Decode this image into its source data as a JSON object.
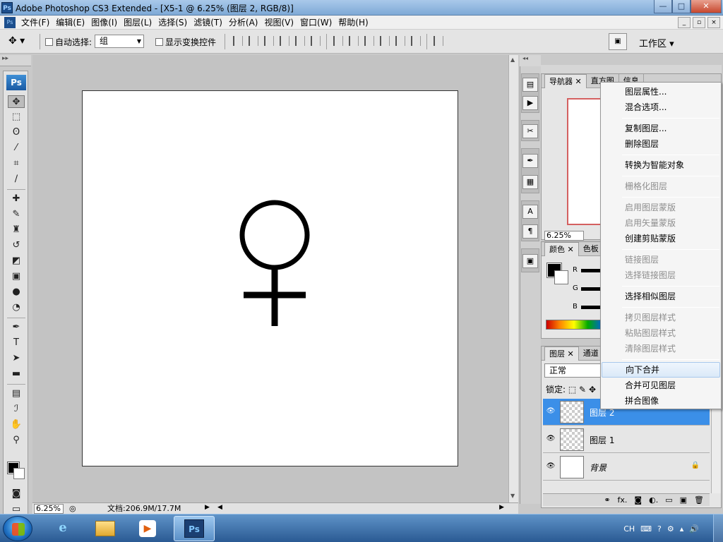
{
  "window": {
    "title": "Adobe Photoshop CS3 Extended - [X5-1 @ 6.25% (图层 2, RGB/8)]",
    "app_icon": "Ps",
    "controls": {
      "minimize": "—",
      "maximize": "□",
      "close": "✕"
    }
  },
  "menu": {
    "items": [
      "文件(F)",
      "编辑(E)",
      "图像(I)",
      "图层(L)",
      "选择(S)",
      "滤镜(T)",
      "分析(A)",
      "视图(V)",
      "窗口(W)",
      "帮助(H)"
    ],
    "doc_controls": [
      "_",
      "▫",
      "×"
    ]
  },
  "options": {
    "auto_select_label": "自动选择:",
    "auto_select_value": "组",
    "show_transform_label": "显示变换控件",
    "workspace_label": "工作区 ▾"
  },
  "toolbox": {
    "logo": "Ps",
    "tools": [
      {
        "name": "move-tool-icon",
        "glyph": "✥"
      },
      {
        "name": "marquee-tool-icon",
        "glyph": "⬚"
      },
      {
        "name": "lasso-tool-icon",
        "glyph": "ʘ"
      },
      {
        "name": "magic-wand-tool-icon",
        "glyph": "⁄"
      },
      {
        "name": "crop-tool-icon",
        "glyph": "⌗"
      },
      {
        "name": "slice-tool-icon",
        "glyph": "∕"
      },
      {
        "name": "healing-brush-tool-icon",
        "glyph": "✚"
      },
      {
        "name": "brush-tool-icon",
        "glyph": "✎"
      },
      {
        "name": "clone-stamp-tool-icon",
        "glyph": "♜"
      },
      {
        "name": "history-brush-tool-icon",
        "glyph": "↺"
      },
      {
        "name": "eraser-tool-icon",
        "glyph": "◩"
      },
      {
        "name": "gradient-tool-icon",
        "glyph": "▣"
      },
      {
        "name": "blur-tool-icon",
        "glyph": "●"
      },
      {
        "name": "dodge-tool-icon",
        "glyph": "◔"
      },
      {
        "name": "pen-tool-icon",
        "glyph": "✒"
      },
      {
        "name": "type-tool-icon",
        "glyph": "T"
      },
      {
        "name": "path-selection-tool-icon",
        "glyph": "➤"
      },
      {
        "name": "shape-tool-icon",
        "glyph": "▬"
      },
      {
        "name": "notes-tool-icon",
        "glyph": "▤"
      },
      {
        "name": "eyedropper-tool-icon",
        "glyph": "ℐ"
      },
      {
        "name": "hand-tool-icon",
        "glyph": "✋"
      },
      {
        "name": "zoom-tool-icon",
        "glyph": "⚲"
      }
    ]
  },
  "status": {
    "zoom": "6.25%",
    "doc_info": "文档:206.9M/17.7M"
  },
  "panels": {
    "navigator_tabs": [
      "导航器",
      "直方图",
      "信息"
    ],
    "navigator_zoom": "6.25%",
    "color_tabs": [
      "颜色",
      "色板"
    ],
    "channels": [
      "R",
      "G",
      "B"
    ],
    "layer_tabs": [
      "图层",
      "通道"
    ],
    "blend_mode": "正常",
    "lock_label": "锁定:",
    "layers": [
      {
        "name": "图层 2",
        "selected": true
      },
      {
        "name": "图层 1",
        "selected": false
      },
      {
        "name": "背景",
        "selected": false
      }
    ],
    "footer_icons": [
      "⚭",
      "fx.",
      "◙",
      "◐.",
      "▭",
      "▣",
      "🗑"
    ]
  },
  "context_menu": {
    "items": [
      {
        "label": "图层属性...",
        "disabled": false
      },
      {
        "label": "混合选项...",
        "disabled": false
      },
      {
        "label": "复制图层...",
        "disabled": false
      },
      {
        "label": "删除图层",
        "disabled": false
      },
      {
        "label": "转换为智能对象",
        "disabled": false
      },
      {
        "label": "栅格化图层",
        "disabled": true
      },
      {
        "label": "启用图层蒙版",
        "disabled": true
      },
      {
        "label": "启用矢量蒙版",
        "disabled": true
      },
      {
        "label": "创建剪贴蒙版",
        "disabled": false
      },
      {
        "label": "链接图层",
        "disabled": true
      },
      {
        "label": "选择链接图层",
        "disabled": true
      },
      {
        "label": "选择相似图层",
        "disabled": false
      },
      {
        "label": "拷贝图层样式",
        "disabled": true
      },
      {
        "label": "粘贴图层样式",
        "disabled": true
      },
      {
        "label": "清除图层样式",
        "disabled": true
      },
      {
        "label": "向下合并",
        "disabled": false,
        "hover": true
      },
      {
        "label": "合并可见图层",
        "disabled": false
      },
      {
        "label": "拼合图像",
        "disabled": false
      }
    ]
  },
  "taskbar": {
    "ie_glyph": "e",
    "media_glyph": "▶",
    "ps_label": "Ps",
    "tray": {
      "lang": "CH"
    }
  },
  "colors": {
    "selected_layer": "#3b8fe8",
    "nav_frame": "#d46060"
  }
}
